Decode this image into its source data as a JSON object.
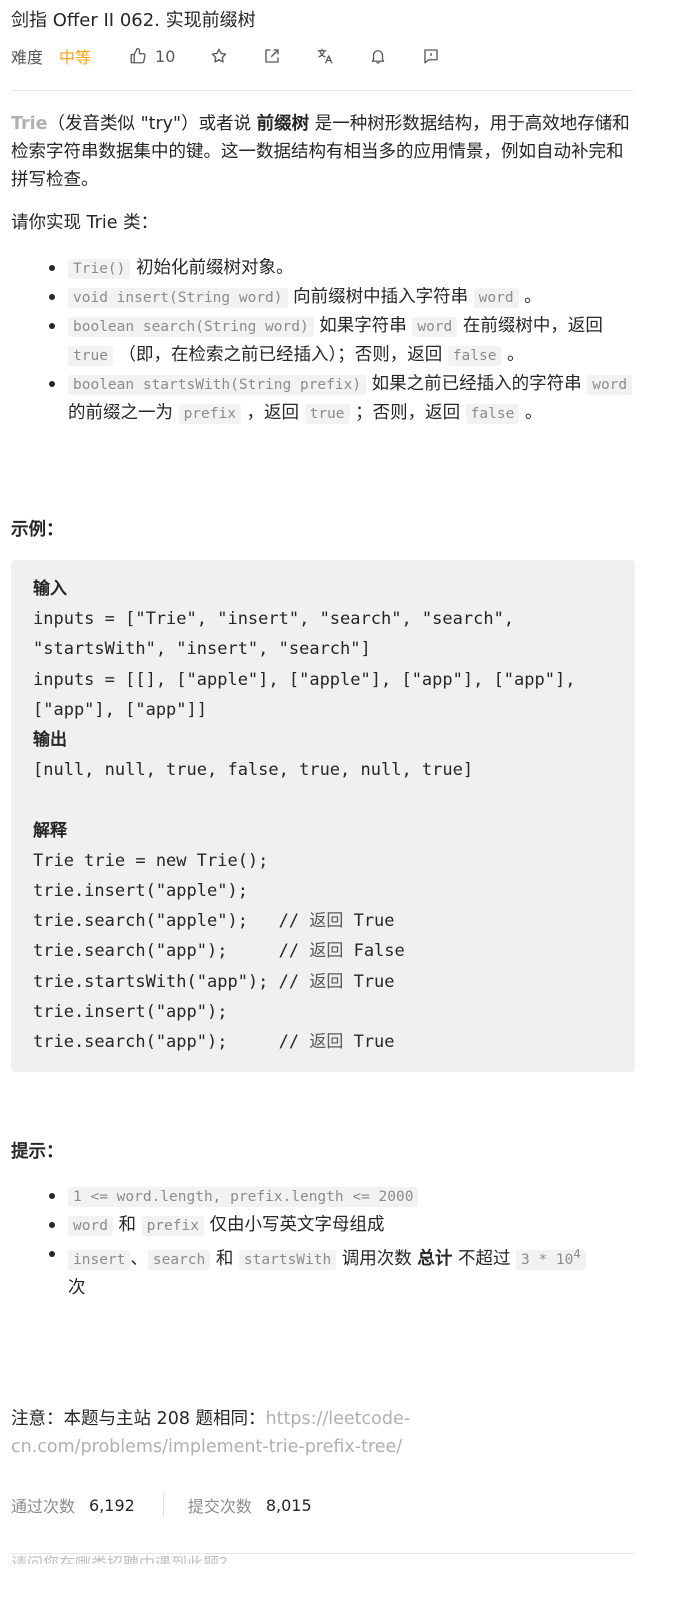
{
  "header": {
    "title": "剑指 Offer II 062. 实现前缀树",
    "difficulty_label": "难度",
    "difficulty_value": "中等",
    "like_count": "10"
  },
  "intro": {
    "trie": "Trie",
    "part1": "（发音类似 \"try\"）或者说 ",
    "bold": "前缀树",
    "part2": " 是一种树形数据结构，用于高效地存储和检索字符串数据集中的键。这一数据结构有相当多的应用情景，例如自动补完和拼写检查。"
  },
  "impl_title": "请你实现 Trie 类：",
  "methods": [
    {
      "code": "Trie()",
      "text": " 初始化前缀树对象。"
    },
    {
      "code": "void insert(String word)",
      "text1": " 向前缀树中插入字符串 ",
      "code2": "word",
      "text2": " 。"
    },
    {
      "code": "boolean search(String word)",
      "text1": " 如果字符串 ",
      "code2": "word",
      "text2": " 在前缀树中，返回 ",
      "code3": "true",
      "text3": " （即，在检索之前已经插入）；否则，返回 ",
      "code4": "false",
      "text4": " 。"
    },
    {
      "code": "boolean startsWith(String prefix)",
      "text1": " 如果之前已经插入的字符串 ",
      "code2": "word",
      "text2": " 的前缀之一为 ",
      "code3": "prefix",
      "text3": " ，返回 ",
      "code4": "true",
      "text4": " ；否则，返回 ",
      "code5": "false",
      "text5": " 。"
    }
  ],
  "example_title": "示例：",
  "example": {
    "input_label": "输入",
    "input_line1": "inputs = [\"Trie\", \"insert\", \"search\", \"search\",",
    "input_line2": "\"startsWith\", \"insert\", \"search\"]",
    "input_line3": "inputs = [[], [\"apple\"], [\"apple\"], [\"app\"], [\"app\"],",
    "input_line4": "[\"app\"], [\"app\"]]",
    "output_label": "输出",
    "output_line": "[null, null, true, false, true, null, true]",
    "explain_label": "解释",
    "lines": [
      {
        "code": "Trie trie = new Trie();",
        "comment": ""
      },
      {
        "code": "trie.insert(\"apple\");",
        "comment": ""
      },
      {
        "code": "trie.search(\"apple\");   // ",
        "comment": "返回",
        "tail": " True"
      },
      {
        "code": "trie.search(\"app\");     // ",
        "comment": "返回",
        "tail": " False"
      },
      {
        "code": "trie.startsWith(\"app\"); // ",
        "comment": "返回",
        "tail": " True"
      },
      {
        "code": "trie.insert(\"app\");",
        "comment": ""
      },
      {
        "code": "trie.search(\"app\");     // ",
        "comment": "返回",
        "tail": " True"
      }
    ]
  },
  "hint_title": "提示：",
  "hints": {
    "h1_code": "1 <= word.length, prefix.length <= 2000",
    "h2_code1": "word",
    "h2_text1": " 和 ",
    "h2_code2": "prefix",
    "h2_text2": " 仅由小写英文字母组成",
    "h3_code1": "insert",
    "h3_text1": "、",
    "h3_code2": "search",
    "h3_text2": " 和 ",
    "h3_code3": "startsWith",
    "h3_text3": " 调用次数 ",
    "h3_bold": "总计",
    "h3_text4": " 不超过 ",
    "h3_code4": "3 * 10",
    "h3_sup": "4",
    "h3_text5": "次"
  },
  "note": {
    "label": "注意：本题与主站 208 题相同：",
    "link": "https://leetcode-cn.com/problems/implement-trie-prefix-tree/"
  },
  "stats": {
    "accepted_label": "通过次数",
    "accepted_value": "6,192",
    "submitted_label": "提交次数",
    "submitted_value": "8,015"
  },
  "footer_cut": "请问您在哪类招聘中遇到此题？"
}
